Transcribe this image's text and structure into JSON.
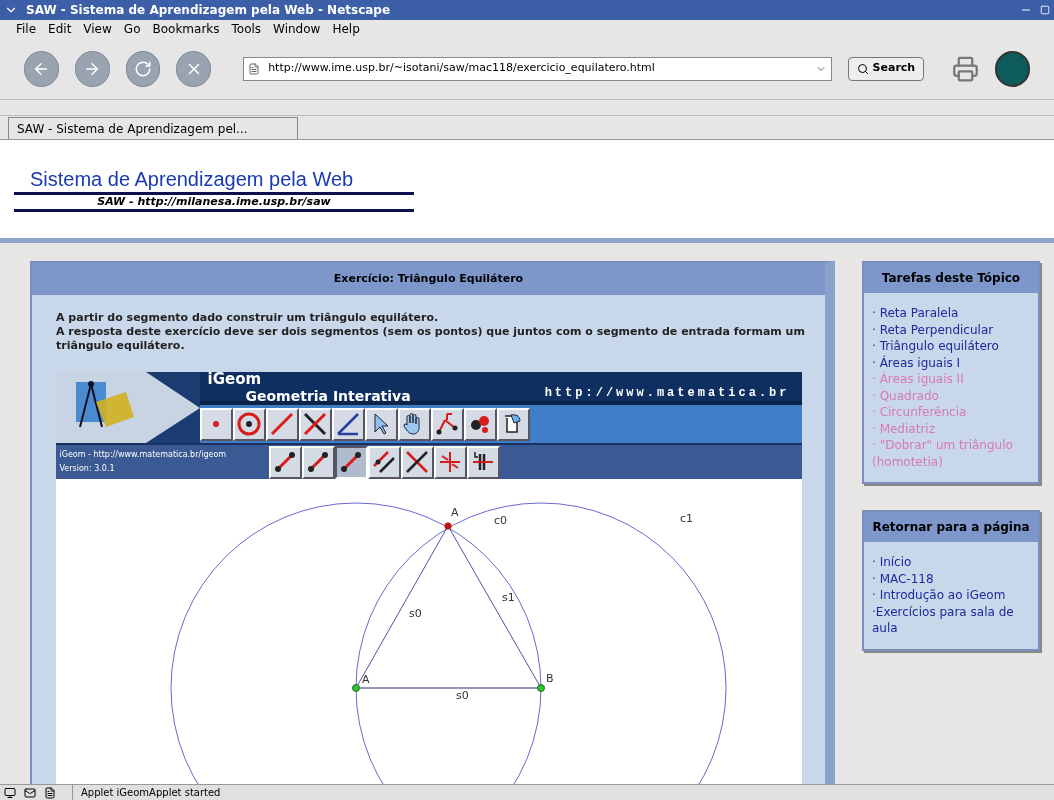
{
  "window": {
    "title": "SAW - Sistema de Aprendizagem pela Web - Netscape"
  },
  "menu": [
    "File",
    "Edit",
    "View",
    "Go",
    "Bookmarks",
    "Tools",
    "Window",
    "Help"
  ],
  "address_bar": {
    "value": "http://www.ime.usp.br/~isotani/saw/mac118/exercicio_equilatero.html"
  },
  "search_button": "Search",
  "tabs": [
    {
      "label": "SAW - Sistema de Aprendizagem pel...",
      "selected": true
    }
  ],
  "site_header": {
    "title": "Sistema de Aprendizagem pela Web",
    "subtitle": "SAW - http://milanesa.ime.usp.br/saw"
  },
  "exercise": {
    "title": "Exercício: Triângulo Equilátero",
    "paragraphs": [
      "A partir do segmento dado construir um triângulo equilátero.",
      "A resposta deste exercício deve ser dois segmentos (sem os pontos) que juntos com o segmento de entrada formam um triângulo equilátero."
    ],
    "applet": {
      "name": "iGeom",
      "subtitle": "Geometria Interativa",
      "url": "http://www.matematica.br",
      "info": [
        "iGeom - http://www.matematica.br/igeom",
        "Version: 3.0.1"
      ],
      "tools_row1": [
        {
          "kind": "point",
          "selected": false
        },
        {
          "kind": "circle",
          "selected": false
        },
        {
          "kind": "line",
          "selected": false
        },
        {
          "kind": "intersection",
          "selected": false
        },
        {
          "kind": "angle",
          "selected": false
        },
        {
          "kind": "pointer",
          "selected": false
        },
        {
          "kind": "hand",
          "selected": false
        },
        {
          "kind": "measure",
          "selected": false
        },
        {
          "kind": "objects",
          "selected": false
        },
        {
          "kind": "script",
          "selected": false
        }
      ],
      "tools_row2": [
        {
          "kind": "segment",
          "selected": false
        },
        {
          "kind": "segment",
          "selected": false
        },
        {
          "kind": "segment",
          "selected": true
        },
        {
          "kind": "parallel",
          "selected": false
        },
        {
          "kind": "perpendicular",
          "selected": false
        },
        {
          "kind": "reflect",
          "selected": false
        },
        {
          "kind": "distance",
          "selected": false
        }
      ],
      "canvas_labels": [
        "A",
        "c0",
        "c1",
        "s0",
        "s1",
        "A",
        "B",
        "s0"
      ]
    }
  },
  "sidebar": [
    {
      "title": "Tarefas deste Tópico",
      "links": [
        {
          "label": "· Reta Paralela",
          "visited": false
        },
        {
          "label": "· Reta Perpendicular",
          "visited": false
        },
        {
          "label": "· Triângulo equilátero",
          "visited": false
        },
        {
          "label": "· Áreas iguais I",
          "visited": false
        },
        {
          "label": "· Áreas iguais II",
          "visited": true
        },
        {
          "label": "· Quadrado",
          "visited": true
        },
        {
          "label": "· Circunferência",
          "visited": true
        },
        {
          "label": "· Mediatriz",
          "visited": true
        },
        {
          "label": "· \"Dobrar\" um triângulo (homotetia)",
          "visited": true
        }
      ]
    },
    {
      "title": "Retornar para a página",
      "links": [
        {
          "label": "· Início",
          "visited": false
        },
        {
          "label": "· MAC-118",
          "visited": false
        },
        {
          "label": "· Introdução ao iGeom",
          "visited": false
        },
        {
          "label": "·Exercícios para sala de aula",
          "visited": false
        }
      ]
    }
  ],
  "status_bar": {
    "message": "Applet iGeomApplet started"
  }
}
